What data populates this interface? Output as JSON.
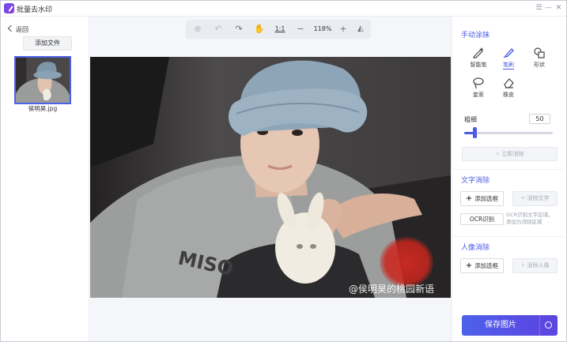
{
  "app": {
    "title": "批量去水印"
  },
  "window": {
    "menu_icon": "menu-icon",
    "minimize_icon": "minimize-icon",
    "close_icon": "close-icon"
  },
  "sidebar": {
    "back_label": "返回",
    "add_file_label": "添加文件",
    "files": [
      {
        "name": "侯明昊.jpg",
        "selected": true
      }
    ]
  },
  "toolbar": {
    "clear_icon": "clear-icon",
    "undo_icon": "undo-icon",
    "redo_icon": "redo-icon",
    "pan_icon": "hand-icon",
    "ratio_label": "1:1",
    "zoom_out": "−",
    "zoom_level": "118%",
    "zoom_in": "+",
    "compare_icon": "compare-icon"
  },
  "canvas": {
    "watermark_text": "@侯明昊的桃园新语"
  },
  "manual": {
    "title": "手动涂抹",
    "tools": [
      {
        "label": "智能笔",
        "icon": "smart-pen-icon"
      },
      {
        "label": "笔刷",
        "icon": "brush-icon",
        "active": true
      },
      {
        "label": "形状",
        "icon": "shape-icon"
      },
      {
        "label": "套索",
        "icon": "lasso-icon"
      },
      {
        "label": "橡皮",
        "icon": "eraser-icon"
      }
    ],
    "thickness_label": "粗细",
    "thickness_value": "50",
    "thickness_fraction": 0.12,
    "erase_now_label": "立即消除"
  },
  "text_removal": {
    "title": "文字消除",
    "add_box_label": "添加选框",
    "remove_text_label": "消除文字",
    "ocr_label": "OCR识别",
    "ocr_note": "OCR识别文字区域，添加为消除区域"
  },
  "portrait_removal": {
    "title": "人像消除",
    "add_box_label": "添加选框",
    "remove_portrait_label": "消除人像"
  },
  "save": {
    "label": "保存图片",
    "settings_icon": "settings-icon"
  },
  "colors": {
    "accent": "#4a5be6",
    "brush_mark": "#c8261e"
  }
}
